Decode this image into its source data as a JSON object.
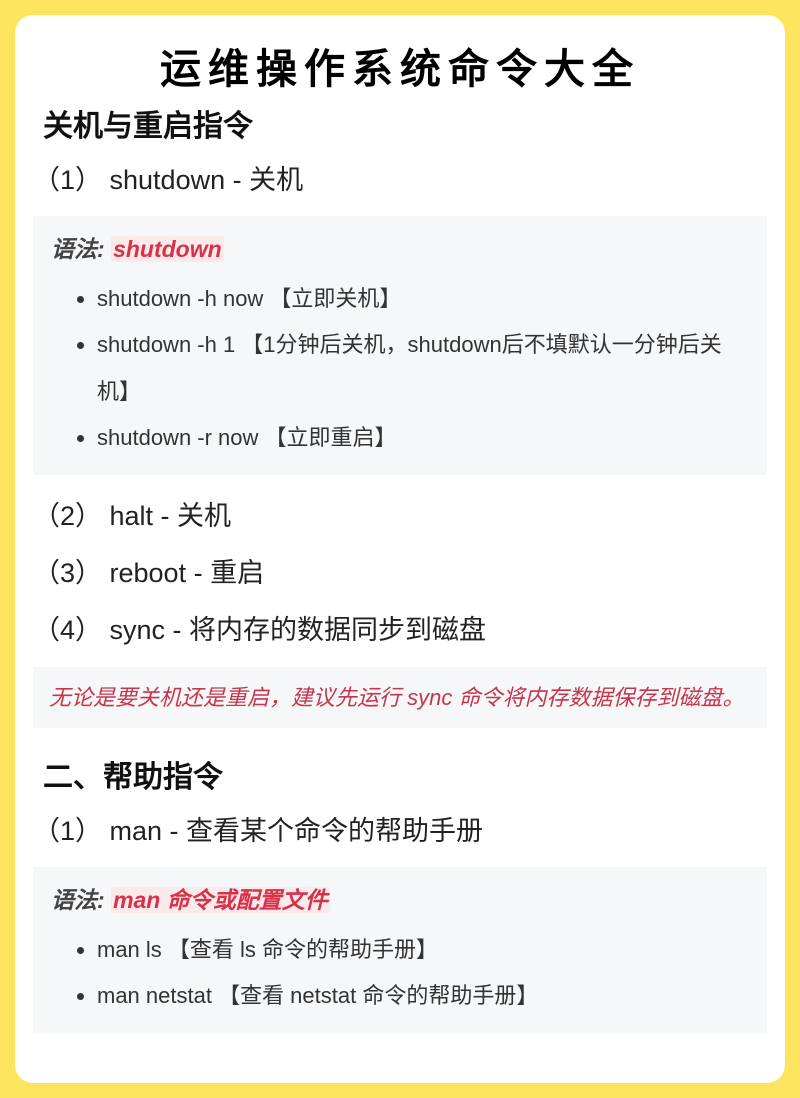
{
  "title": "运维操作系统命令大全",
  "section1": {
    "heading": "关机与重启指令",
    "items": {
      "i1": "（1） shutdown - 关机",
      "i2": "（2） halt - 关机",
      "i3": "（3） reboot - 重启",
      "i4": "（4） sync - 将内存的数据同步到磁盘"
    },
    "syntax1": {
      "label": "语法: ",
      "cmd": "shutdown",
      "bullets": {
        "b1": "shutdown -h now 【立即关机】",
        "b2": "shutdown -h 1 【1分钟后关机，shutdown后不填默认一分钟后关机】",
        "b3": "shutdown -r now 【立即重启】"
      }
    },
    "note": "无论是要关机还是重启，建议先运行 sync 命令将内存数据保存到磁盘。"
  },
  "section2": {
    "heading": "二、帮助指令",
    "items": {
      "i1": "（1） man - 查看某个命令的帮助手册"
    },
    "syntax1": {
      "label": "语法: ",
      "cmd": "man 命令或配置文件",
      "bullets": {
        "b1": "man ls 【查看 ls 命令的帮助手册】",
        "b2": "man netstat 【查看 netstat 命令的帮助手册】"
      }
    }
  }
}
